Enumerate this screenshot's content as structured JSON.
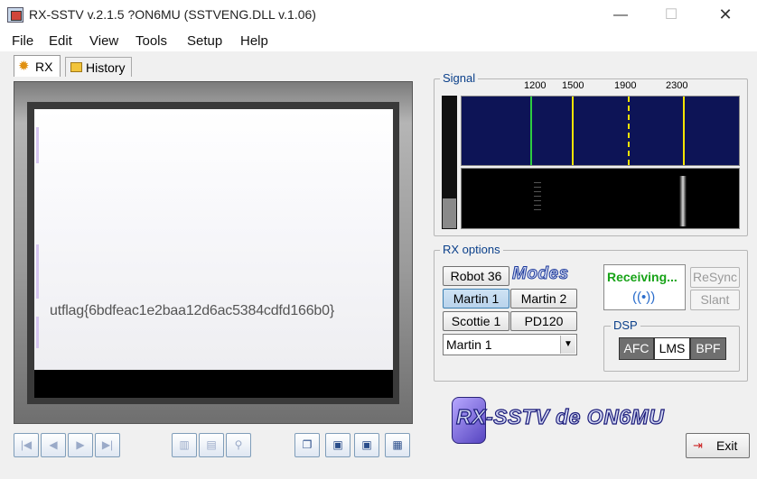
{
  "window": {
    "title": "RX-SSTV v.2.1.5 ?ON6MU (SSTVENG.DLL v.1.06)",
    "min_glyph": "—",
    "max_glyph": "☐",
    "close_glyph": "✕"
  },
  "menu": [
    "File",
    "Edit",
    "View",
    "Tools",
    "Setup",
    "Help"
  ],
  "tabs": [
    {
      "label": "RX",
      "icon": "gear-icon",
      "active": true
    },
    {
      "label": "History",
      "icon": "history-icon",
      "active": false
    }
  ],
  "image": {
    "decoded_text": "utflag{6bdfeac1e2baa12d6ac5384cdfd166b0}"
  },
  "toolbar": {
    "first_glyph": "|◀",
    "prev_glyph": "◀",
    "next_glyph": "▶",
    "last_glyph": "▶|",
    "delete_glyph": "▥",
    "open_glyph": "▤",
    "zoom_glyph": "⚲",
    "copy_glyph": "❐",
    "save_glyph": "▣",
    "saveas_glyph": "▣",
    "settings_glyph": "▦"
  },
  "signal": {
    "label": "Signal",
    "freq_ticks": [
      "1200",
      "1500",
      "1900",
      "2300"
    ]
  },
  "rx_options": {
    "label": "RX options",
    "modes_logo": "Modes",
    "mode_buttons": [
      {
        "label": "Robot 36",
        "pressed": false
      },
      {
        "label": "Martin 1",
        "pressed": true
      },
      {
        "label": "Martin 2",
        "pressed": false
      },
      {
        "label": "Scottie 1",
        "pressed": false
      },
      {
        "label": "PD120",
        "pressed": false
      }
    ],
    "selected_mode": "Martin 1",
    "status": "Receiving...",
    "resync_label": "ReSync",
    "slant_label": "Slant",
    "dsp": {
      "label": "DSP",
      "afc_label": "AFC",
      "lms_label": "LMS",
      "bpf_label": "BPF"
    }
  },
  "logo_text": "RX-SSTV de ON6MU",
  "exit_label": "Exit",
  "colors": {
    "spectrum_bg": "#0d1456",
    "marker_green": "#2ecc40",
    "marker_yellow": "#f5e400",
    "status_green": "#17a317",
    "title_blue": "#0a3f8a"
  }
}
